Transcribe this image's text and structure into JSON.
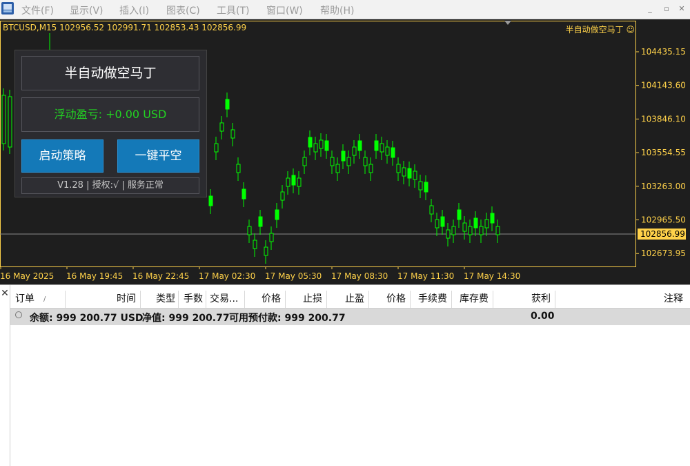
{
  "menu": {
    "items": [
      "文件(F)",
      "显示(V)",
      "插入(I)",
      "图表(C)",
      "工具(T)",
      "窗口(W)",
      "帮助(H)"
    ],
    "controls": [
      "_",
      "▫",
      "✕"
    ]
  },
  "chart": {
    "symbol_title": "BTCUSD,M15  102956.52 102991.71 102853.43 102856.99",
    "ea_label": "半自动做空马丁 ☺",
    "current_price": "102856.99",
    "price_ticks": [
      "104435.15",
      "104143.60",
      "103846.10",
      "103554.55",
      "103263.00",
      "102965.50",
      "102673.95"
    ],
    "time_ticks": [
      "16 May 2025",
      "16 May 19:45",
      "16 May 22:45",
      "17 May 02:30",
      "17 May 05:30",
      "17 May 08:30",
      "17 May 11:30",
      "17 May 14:30"
    ],
    "colors": {
      "background": "#1e1e1e",
      "candle": "#00ff00",
      "axis": "#ffd24a",
      "price_line": "#8a8a8a"
    }
  },
  "ea_panel": {
    "title": "半自动做空马丁",
    "floating_pnl": "浮动盈亏: +0.00 USD",
    "start_button": "启动策略",
    "close_all_button": "一键平空",
    "status": "V1.28 | 授权:√ | 服务正常",
    "colors": {
      "pnl": "#22d322",
      "button": "#1479b8"
    }
  },
  "orders": {
    "close_label": "✕",
    "columns": [
      "订单",
      "/",
      "时间",
      "类型",
      "手数",
      "交易...",
      "价格",
      "止损",
      "止盈",
      "价格",
      "手续费",
      "库存费",
      "获利",
      "注释"
    ],
    "balance_row": {
      "balance": "余额: 999 200.77 USD",
      "equity": "净值: 999 200.77",
      "free_margin": "可用预付款: 999 200.77",
      "profit": "0.00"
    }
  }
}
